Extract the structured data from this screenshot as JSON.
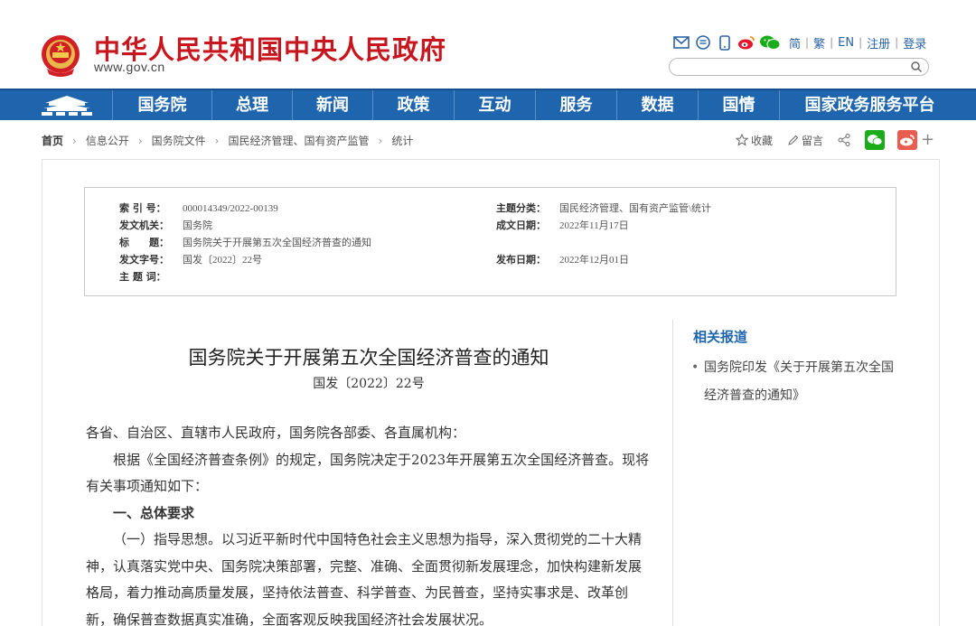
{
  "header": {
    "site_title": "中华人民共和国中央人民政府",
    "site_url": "www.gov.cn",
    "lang_links": [
      "简",
      "繁",
      "EN",
      "注册",
      "登录"
    ],
    "search_placeholder": ""
  },
  "nav": {
    "items": [
      "国务院",
      "总理",
      "新闻",
      "政策",
      "互动",
      "服务",
      "数据",
      "国情",
      "国家政务服务平台"
    ]
  },
  "breadcrumb": [
    "首页",
    "信息公开",
    "国务院文件",
    "国民经济管理、国有资产监管",
    "统计"
  ],
  "actions": {
    "favorite": "收藏",
    "comment": "留言"
  },
  "meta": {
    "index_label": "索 引 号：",
    "index_value": "000014349/2022-00139",
    "topic_label": "主题分类：",
    "topic_value": "国民经济管理、国有资产监管\\统计",
    "issuer_label": "发文机关：",
    "issuer_value": "国务院",
    "date_label": "成文日期：",
    "date_value": "2022年11月17日",
    "title_label": "标　　题：",
    "title_value": "国务院关于开展第五次全国经济普查的通知",
    "docno_label": "发文字号：",
    "docno_value": "国发〔2022〕22号",
    "publish_label": "发布日期：",
    "publish_value": "2022年12月01日",
    "keywords_label": "主 题 词："
  },
  "article": {
    "title": "国务院关于开展第五次全国经济普查的通知",
    "doc_no": "国发〔2022〕22号",
    "p1": "各省、自治区、直辖市人民政府，国务院各部委、各直属机构：",
    "p2": "根据《全国经济普查条例》的规定，国务院决定于2023年开展第五次全国经济普查。现将有关事项通知如下：",
    "h1": "一、总体要求",
    "p3": "（一）指导思想。以习近平新时代中国特色社会主义思想为指导，深入贯彻党的二十大精神，认真落实党中央、国务院决策部署，完整、准确、全面贯彻新发展理念，加快构建新发展格局，着力推动高质量发展，坚持依法普查、科学普查、为民普查，坚持实事求是、改革创新，确保普查数据真实准确，全面客观反映我国经济社会发展状况。"
  },
  "sidebar": {
    "title": "相关报道",
    "item": "国务院印发《关于开展第五次全国经济普查的通知》"
  },
  "colors": {
    "brand_red": "#c8161e",
    "nav_blue": "#1e65ad",
    "link_blue": "#2b64a6"
  }
}
